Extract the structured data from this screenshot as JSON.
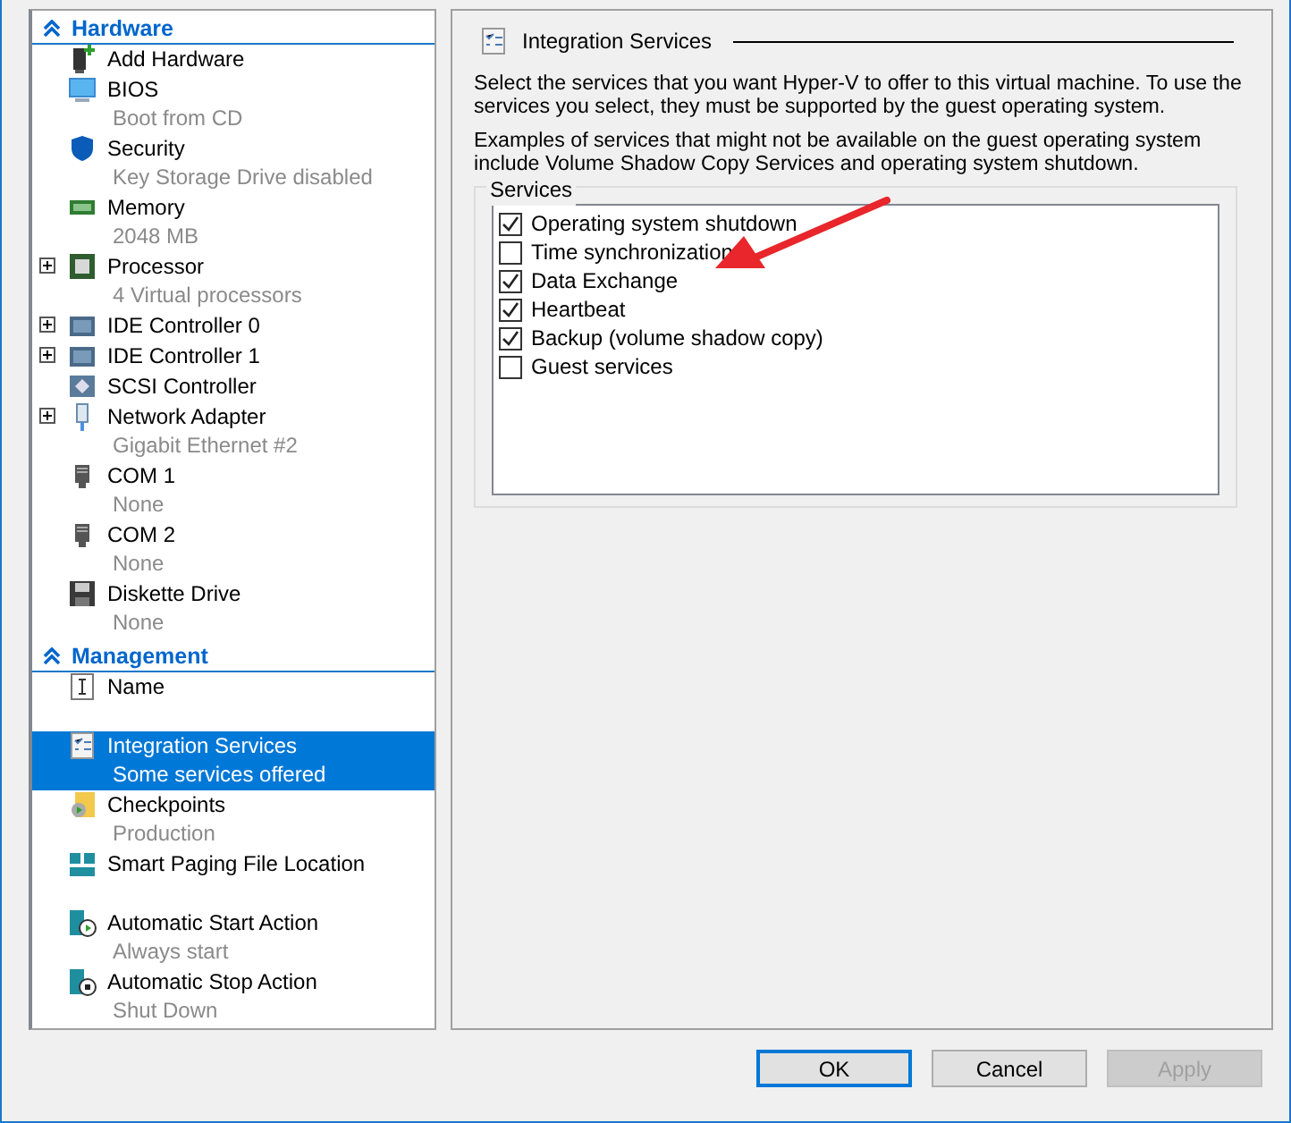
{
  "sections": [
    {
      "title": "Hardware",
      "items": [
        {
          "kind": "add",
          "label": "Add Hardware",
          "expandable": false,
          "selected": false
        },
        {
          "kind": "monitor",
          "label": "BIOS",
          "detail": "Boot from CD",
          "expandable": false,
          "selected": false
        },
        {
          "kind": "shield",
          "label": "Security",
          "detail": "Key Storage Drive disabled",
          "expandable": false,
          "selected": false
        },
        {
          "kind": "memory",
          "label": "Memory",
          "detail": "2048 MB",
          "expandable": false,
          "selected": false
        },
        {
          "kind": "chip",
          "label": "Processor",
          "detail": "4 Virtual processors",
          "expandable": true,
          "selected": false
        },
        {
          "kind": "drive",
          "label": "IDE Controller 0",
          "expandable": true,
          "selected": false
        },
        {
          "kind": "drive",
          "label": "IDE Controller 1",
          "expandable": true,
          "selected": false
        },
        {
          "kind": "scsi",
          "label": "SCSI Controller",
          "expandable": false,
          "selected": false
        },
        {
          "kind": "network",
          "label": "Network Adapter",
          "detail": "Gigabit Ethernet #2",
          "expandable": true,
          "selected": false
        },
        {
          "kind": "port",
          "label": "COM 1",
          "detail": "None",
          "expandable": false,
          "selected": false
        },
        {
          "kind": "port",
          "label": "COM 2",
          "detail": "None",
          "expandable": false,
          "selected": false
        },
        {
          "kind": "floppy",
          "label": "Diskette Drive",
          "detail": "None",
          "expandable": false,
          "selected": false
        }
      ]
    },
    {
      "title": "Management",
      "items": [
        {
          "kind": "name",
          "label": "Name",
          "expandable": false,
          "selected": false,
          "tall": true
        },
        {
          "kind": "services",
          "label": "Integration Services",
          "detail": "Some services offered",
          "expandable": false,
          "selected": true
        },
        {
          "kind": "checkpoint",
          "label": "Checkpoints",
          "detail": "Production",
          "expandable": false,
          "selected": false
        },
        {
          "kind": "paging",
          "label": "Smart Paging File Location",
          "expandable": false,
          "selected": false,
          "tall": true
        },
        {
          "kind": "start",
          "label": "Automatic Start Action",
          "detail": "Always start",
          "expandable": false,
          "selected": false
        },
        {
          "kind": "stop",
          "label": "Automatic Stop Action",
          "detail": "Shut Down",
          "expandable": false,
          "selected": false
        }
      ]
    }
  ],
  "panel": {
    "title": "Integration Services",
    "paragraphs": [
      "Select the services that you want Hyper-V to offer to this virtual machine. To use the services you select, they must be supported by the guest operating system.",
      "Examples of services that might not be available on the guest operating system include Volume Shadow Copy Services and operating system shutdown."
    ],
    "group_label": "Services",
    "services": [
      {
        "label": "Operating system shutdown",
        "checked": true
      },
      {
        "label": "Time synchronization",
        "checked": false
      },
      {
        "label": "Data Exchange",
        "checked": true
      },
      {
        "label": "Heartbeat",
        "checked": true
      },
      {
        "label": "Backup (volume shadow copy)",
        "checked": true
      },
      {
        "label": "Guest services",
        "checked": false
      }
    ]
  },
  "buttons": [
    {
      "label": "OK",
      "default": true,
      "disabled": false
    },
    {
      "label": "Cancel",
      "default": false,
      "disabled": false
    },
    {
      "label": "Apply",
      "default": false,
      "disabled": true
    }
  ]
}
